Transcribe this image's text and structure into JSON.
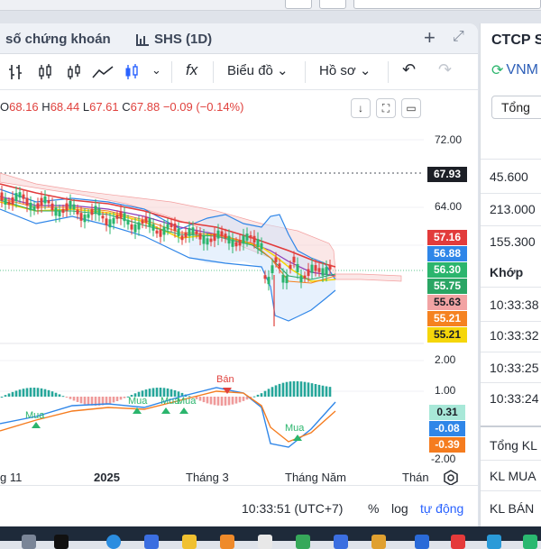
{
  "header": {
    "title": "số chứng khoán",
    "symbol": "SHS (1D)",
    "plus": "+",
    "expand": "⤢"
  },
  "toolbar": {
    "indicator_icon": "fx",
    "chart_label": "Biểu đồ",
    "profile_label": "Hồ sơ",
    "undo": "↶",
    "redo": "↷"
  },
  "ohlc": {
    "o_label": "O",
    "o": "68.16",
    "h_label": "H",
    "h": "68.44",
    "l_label": "L",
    "l": "67.61",
    "c_label": "C",
    "c": "67.88",
    "change": "−0.09 (−0.14%)"
  },
  "price_axis": {
    "ticks": [
      "72.00",
      "64.00"
    ],
    "tags": [
      {
        "value": "67.93",
        "bg": "#1c1f26",
        "fg": "#ffffff"
      },
      {
        "value": "57.16",
        "bg": "#e23b3b",
        "fg": "#ffffff"
      },
      {
        "value": "56.88",
        "bg": "#2f86e8",
        "fg": "#ffffff"
      },
      {
        "value": "56.30",
        "bg": "#2bb56d",
        "fg": "#ffffff"
      },
      {
        "value": "55.75",
        "bg": "#2aa564",
        "fg": "#ffffff"
      },
      {
        "value": "55.63",
        "bg": "#f2a3a3",
        "fg": "#1c1f26"
      },
      {
        "value": "55.21",
        "bg": "#f58220",
        "fg": "#ffffff"
      },
      {
        "value": "55.21",
        "bg": "#f5d60a",
        "fg": "#1c1f26"
      }
    ]
  },
  "macd_axis": {
    "ticks": [
      "2.00",
      "1.00",
      "-2.00"
    ],
    "tags": [
      {
        "value": "0.31",
        "bg": "#a8e8d8",
        "fg": "#1c1f26"
      },
      {
        "value": "-0.08",
        "bg": "#2f86e8",
        "fg": "#ffffff"
      },
      {
        "value": "-0.39",
        "bg": "#f57c1f",
        "fg": "#ffffff"
      }
    ],
    "signals": {
      "sell": "Bán",
      "buy": "Mua"
    }
  },
  "time_axis": [
    "g 11",
    "2025",
    "Tháng 3",
    "Tháng Năm",
    "Thán"
  ],
  "footer": {
    "time": "10:33:51 (UTC+7)",
    "percent": "%",
    "log": "log",
    "auto": "tự động"
  },
  "right_panel": {
    "title": "CTCP S",
    "symbol": "VNM",
    "button": "Tổng",
    "volumes": [
      "45.600",
      "213.000",
      "155.300"
    ],
    "match_label": "Khớp",
    "times": [
      "10:33:38",
      "10:33:32",
      "10:33:25",
      "10:33:24"
    ],
    "total_label": "Tổng KL",
    "buy_label": "KL MUA",
    "sell_label": "KL BÁN"
  },
  "colors": {
    "up": "#2bb56d",
    "down": "#e0413d",
    "accent": "#2962ff"
  }
}
